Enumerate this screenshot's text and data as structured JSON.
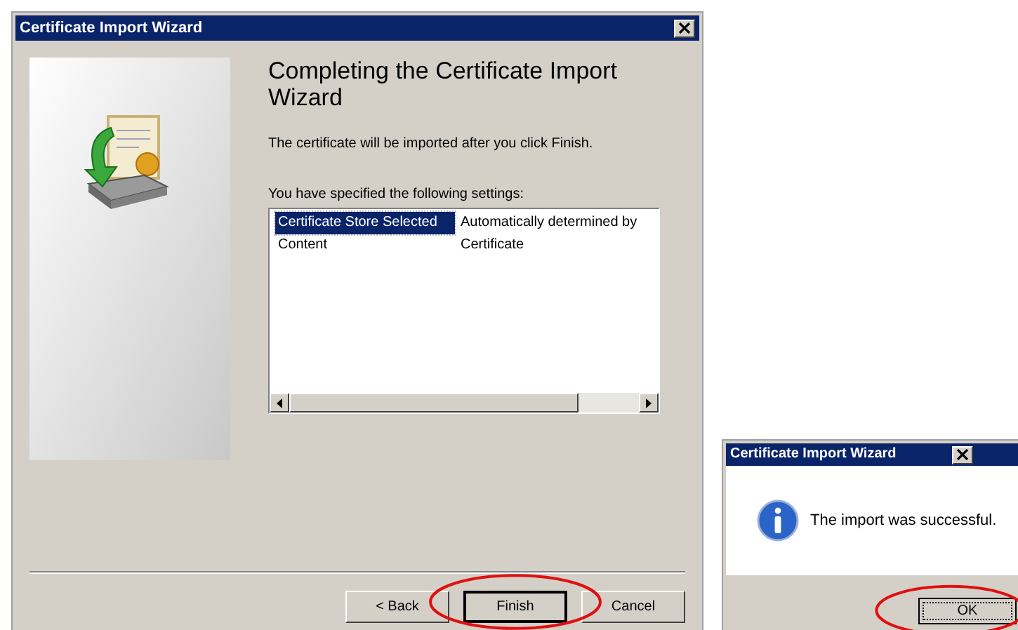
{
  "wizard": {
    "title": "Certificate Import Wizard",
    "heading": "Completing the Certificate Import Wizard",
    "description": "The certificate will be imported after you click Finish.",
    "settings_label": "You have specified the following settings:",
    "settings": [
      {
        "name": "Certificate Store Selected",
        "value": "Automatically determined by",
        "selected": true
      },
      {
        "name": "Content",
        "value": "Certificate",
        "selected": false
      }
    ],
    "buttons": [
      {
        "label": "< Back",
        "default": false
      },
      {
        "label": "Finish",
        "default": true
      },
      {
        "label": "Cancel",
        "default": false
      }
    ]
  },
  "message_box": {
    "title": "Certificate Import Wizard",
    "message": "The import was successful.",
    "button": "OK"
  }
}
